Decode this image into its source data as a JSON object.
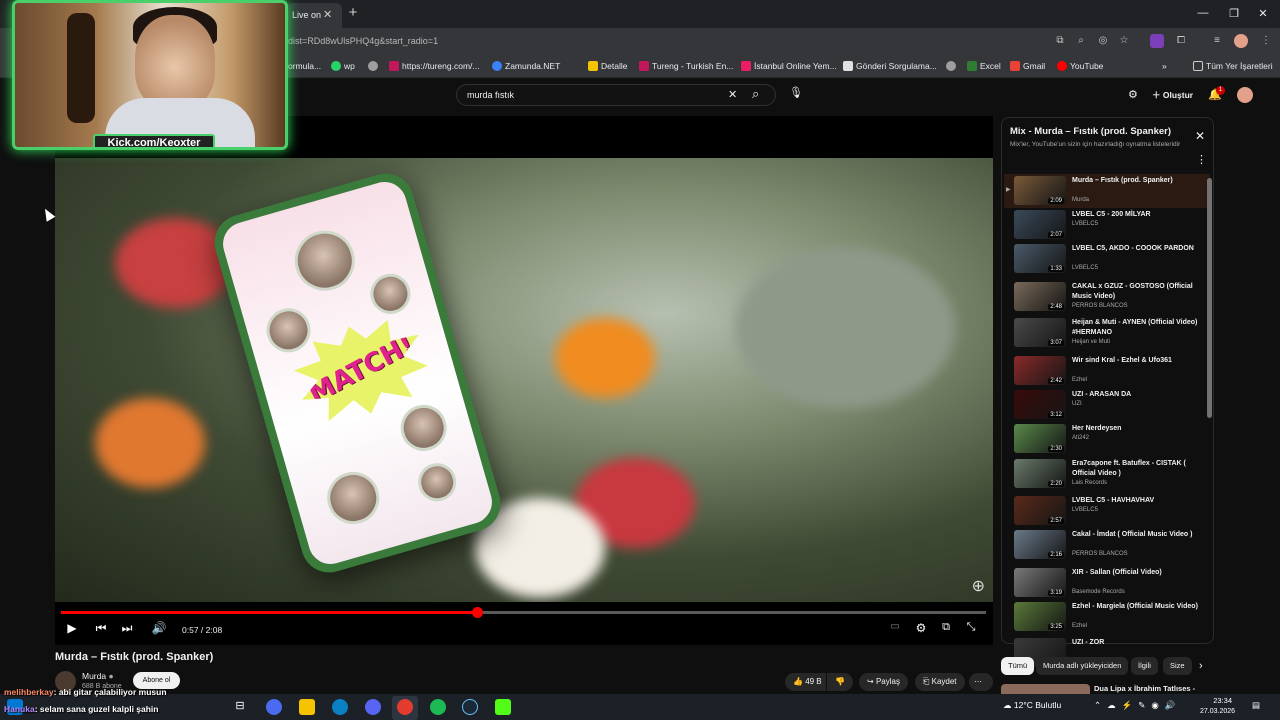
{
  "browser": {
    "tab_title": "Live on",
    "url": "dist=RDd8wUlsPHQ4g&start_radio=1",
    "bookmarks": [
      {
        "label": "ormula...",
        "color": "#6d6d6d"
      },
      {
        "label": "wp",
        "color": "#25d366"
      },
      {
        "label": "",
        "color": "#9e9e9e"
      },
      {
        "label": "https://tureng.com/...",
        "color": "#c2185b"
      },
      {
        "label": "Zamunda.NET",
        "color": "#3b82f6"
      },
      {
        "label": "Detalle",
        "color": "#f5c400"
      },
      {
        "label": "Tureng - Turkish En...",
        "color": "#c2185b"
      },
      {
        "label": "İstanbul Online Yem...",
        "color": "#e91e63"
      },
      {
        "label": "Gönderi Sorgulama...",
        "color": "#e0e0e0"
      },
      {
        "label": "",
        "color": "#9e9e9e"
      },
      {
        "label": "Excel",
        "color": "#2e7d32"
      },
      {
        "label": "Gmail",
        "color": "#ea4335"
      },
      {
        "label": "YouTube",
        "color": "#ff0000"
      }
    ],
    "all_bookmarks": "Tüm Yer İşaretleri"
  },
  "youtube": {
    "search_value": "murda fıstık",
    "create_label": "Oluştur",
    "notif_count": "1",
    "video": {
      "title": "Murda – Fıstık (prod. Spanker)",
      "time": "0:57 / 2:08",
      "progress": 0.45,
      "channel": "Murda",
      "subscribers": "688 B abone",
      "subscribe_label": "Abone ol",
      "likes": "49 B",
      "share_label": "Paylaş",
      "save_label": "Kaydet",
      "overlay_text": "MATCH!"
    },
    "playlist": {
      "title": "Mix - Murda – Fıstık (prod. Spanker)",
      "subtitle": "Mix'ler, YouTube'un sizin için hazırladığı oynatma listeleridir",
      "items": [
        {
          "title": "Murda – Fıstık (prod. Spanker)",
          "author": "Murda",
          "duration": "2:09",
          "color": "#7a5a3a"
        },
        {
          "title": "LVBEL C5 - 200 MİLYAR",
          "author": "LVBELC5",
          "duration": "2:07",
          "color": "#3a4a5a"
        },
        {
          "title": "LVBEL C5, AKDO - COOOK PARDON",
          "author": "LVBELC5",
          "duration": "1:33",
          "color": "#4a5a6a"
        },
        {
          "title": "CAKAL x GZUZ - GOSTOSO (Official Music Video)",
          "author": "PERROS BLANCOS",
          "duration": "2:48",
          "color": "#7a6a5a"
        },
        {
          "title": "Heijan & Muti - AYNEN (Official Video) #HERMANO",
          "author": "Heijan ve Muti",
          "duration": "3:07",
          "color": "#4a4a4a"
        },
        {
          "title": "Wir sind Kral - Ezhel & Ufo361",
          "author": "Ezhel",
          "duration": "2:42",
          "color": "#8a2a2a"
        },
        {
          "title": "UZI - ARASAN DA",
          "author": "UZI",
          "duration": "3:12",
          "color": "#3a0a0a"
        },
        {
          "title": "Her Nerdeysen",
          "author": "Ati242",
          "duration": "2:30",
          "color": "#5a8a4a"
        },
        {
          "title": "Era7capone ft. Batuflex - CISTAK ( Official Video )",
          "author": "Lais Records",
          "duration": "2:20",
          "color": "#6a7a6a"
        },
        {
          "title": "LVBEL C5 - HAVHAVHAV",
          "author": "LVBELC5",
          "duration": "2:57",
          "color": "#5a2a1a"
        },
        {
          "title": "Cakal - İmdat ( Official Music Video )",
          "author": "PERROS BLANCOS",
          "duration": "2:16",
          "color": "#6a7a8a"
        },
        {
          "title": "XIR - Sallan (Official Video)",
          "author": "Basemode Records",
          "duration": "3:19",
          "color": "#7a7a7a"
        },
        {
          "title": "Ezhel - Margiela (Official Music Video)",
          "author": "Ezhel",
          "duration": "3:25",
          "color": "#5a7a3a"
        },
        {
          "title": "UZI - ZOR",
          "author": "",
          "duration": "",
          "color": "#3a3a3a"
        }
      ]
    },
    "chips": [
      "Tümü",
      "Murda adlı yükleyiciden",
      "İlgili",
      "Size"
    ],
    "next_video_title": "Dua Lipa x İbrahim Tatlıses -"
  },
  "stream": {
    "kick_label": "Kick.com/Keoxter",
    "chat_lines": [
      {
        "user": "melihberkay",
        "text": ": abi gitar çalabiliyor musun",
        "color": "#ff8a65"
      },
      {
        "user": "Hanuka",
        "text": ": selam sana guzel kalpli şahin",
        "color": "#b388ff"
      }
    ]
  },
  "taskbar": {
    "weather": "12°C Bulutlu",
    "time": "23:34",
    "date": "27.03.2026"
  }
}
